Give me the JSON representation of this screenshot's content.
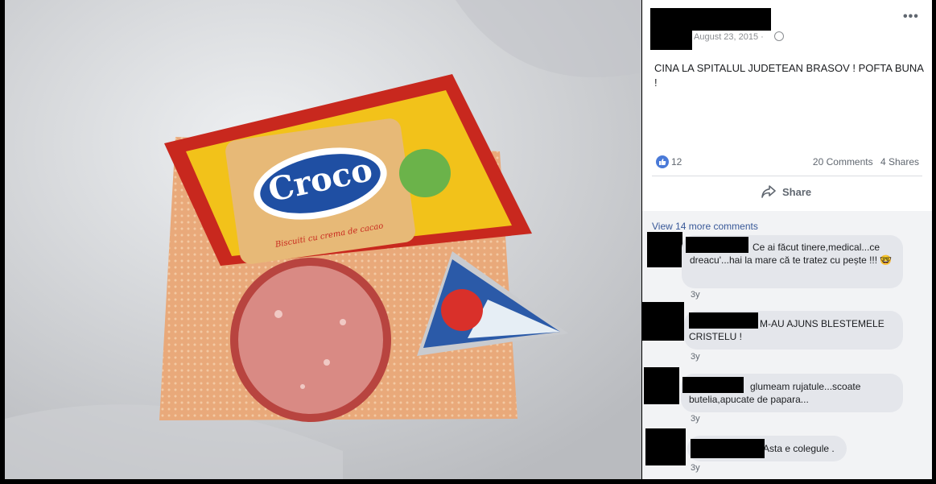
{
  "post": {
    "date": "August 23, 2015 ·",
    "text": "CINA LA SPITALUL JUDETEAN BRASOV ! POFTA BUNA !",
    "menu_glyph": "•••",
    "like_count": "12",
    "comments_count": "20 Comments",
    "shares_count": "4 Shares",
    "share_label": "Share"
  },
  "photo": {
    "biscuit_brand": "Croco",
    "biscuit_subtitle": "Biscuiti cu crema de cacao",
    "colors": {
      "cloth": "#d8d9dc",
      "napkin": "#e9a97a",
      "wrapper_yellow": "#f2c21a",
      "wrapper_red": "#c8281e",
      "salami": "#d98a84",
      "cheese_blue": "#2b5aa8"
    }
  },
  "comments": {
    "view_more": "View 14 more comments",
    "items": [
      {
        "text": "Ce ai făcut tinere,medical...ce dreacu'...hai la mare că te tratez cu pește !!! 🤓",
        "time": "3y"
      },
      {
        "text": "M-AU AJUNS BLESTEMELE CRISTELU !",
        "time": "3y"
      },
      {
        "text": "glumeam rujatule...scoate butelia,apucate de papara...",
        "time": "3y"
      },
      {
        "text": "Asta e colegule .",
        "time": "3y"
      }
    ]
  }
}
